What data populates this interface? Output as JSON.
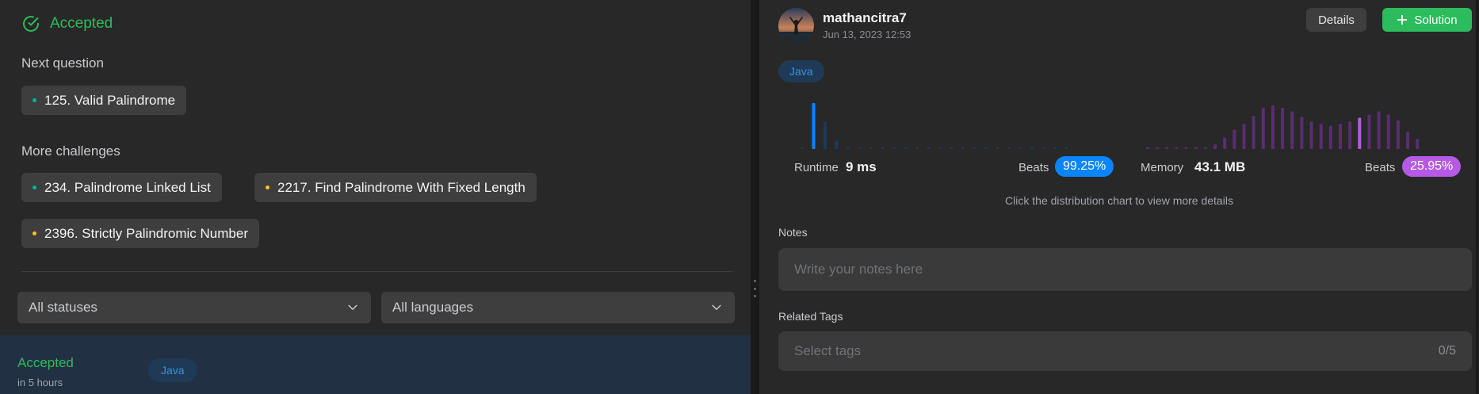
{
  "left": {
    "status": "Accepted",
    "next_question_label": "Next question",
    "next_question": {
      "label": "125. Valid Palindrome",
      "difficulty": "easy"
    },
    "more_challenges_label": "More challenges",
    "challenges": [
      {
        "label": "234. Palindrome Linked List",
        "difficulty": "easy"
      },
      {
        "label": "2217. Find Palindrome With Fixed Length",
        "difficulty": "medium"
      },
      {
        "label": "2396. Strictly Palindromic Number",
        "difficulty": "medium"
      }
    ],
    "status_filter": "All statuses",
    "language_filter": "All languages",
    "submission": {
      "status": "Accepted",
      "time": "in 5 hours",
      "language": "Java"
    }
  },
  "right": {
    "username": "mathancitra7",
    "date": "Jun 13, 2023 12:53",
    "details_button": "Details",
    "solution_button": "Solution",
    "language": "Java",
    "runtime": {
      "label": "Runtime",
      "value": "9 ms",
      "beats_label": "Beats",
      "beats_value": "99.25%"
    },
    "memory": {
      "label": "Memory",
      "value": "43.1 MB",
      "beats_label": "Beats",
      "beats_value": "25.95%"
    },
    "hint": "Click the distribution chart to view more details",
    "notes_label": "Notes",
    "notes_placeholder": "Write your notes here",
    "tags_label": "Related Tags",
    "tags_placeholder": "Select tags",
    "tags_count": "0/5"
  },
  "colors": {
    "accepted": "#2cbb5d",
    "runtime_accent": "#0a84ff",
    "memory_accent": "#b659e6",
    "easy": "#00b8a3",
    "medium": "#ffc01e"
  },
  "chart_data": [
    {
      "type": "bar",
      "series": "runtime distribution",
      "values": [
        0.0,
        1.0,
        0.6,
        0.18,
        0.03,
        0.03,
        0.03,
        0.03,
        0.03,
        0.03,
        0.03,
        0.03,
        0.03,
        0.03,
        0.03,
        0.03,
        0.03,
        0.03,
        0.03,
        0.03,
        0.03,
        0.03,
        0.03,
        0.03,
        0.03
      ],
      "highlight_index": 1
    },
    {
      "type": "bar",
      "series": "memory distribution",
      "values": [
        0.03,
        0.03,
        0.03,
        0.03,
        0.03,
        0.03,
        0.03,
        0.1,
        0.25,
        0.42,
        0.55,
        0.72,
        0.9,
        0.95,
        0.9,
        0.82,
        0.7,
        0.6,
        0.55,
        0.5,
        0.55,
        0.6,
        0.68,
        0.75,
        0.82,
        0.75,
        0.62,
        0.38,
        0.22
      ],
      "highlight_index": 22
    }
  ]
}
